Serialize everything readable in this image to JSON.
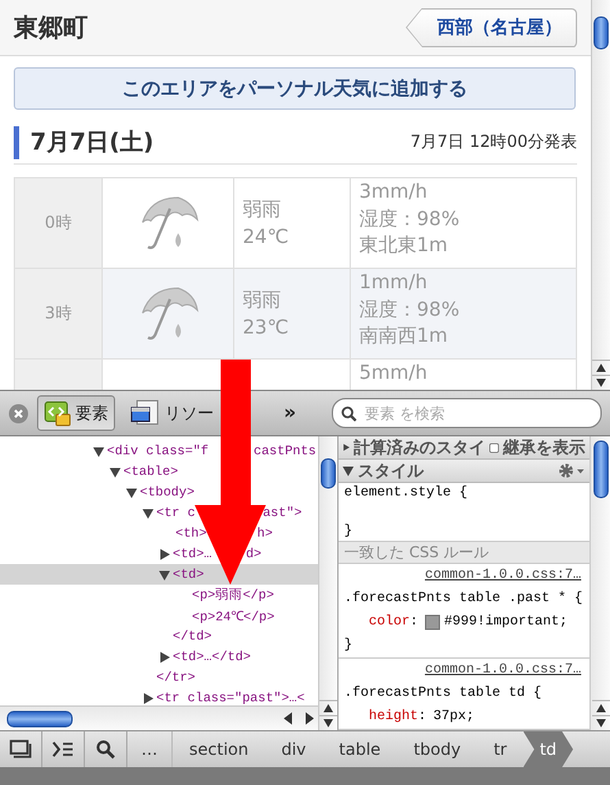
{
  "page": {
    "location": "東郷町",
    "region_button": "西部（名古屋）",
    "add_button": "このエリアをパーソナル天気に追加する",
    "date": "7月7日(土)",
    "published": "7月7日 12時00分発表",
    "forecast": [
      {
        "hour": "0時",
        "weather": "弱雨",
        "temp": "24℃",
        "precip": "3mm/h",
        "humidity": "湿度：98%",
        "wind": "東北東1m",
        "shaded": false
      },
      {
        "hour": "3時",
        "weather": "弱雨",
        "temp": "23℃",
        "precip": "1mm/h",
        "humidity": "湿度：98%",
        "wind": "南南西1m",
        "shaded": true
      },
      {
        "precip": "5mm/h",
        "shaded": false
      }
    ]
  },
  "inspector": {
    "tabs": [
      {
        "label": "要素",
        "selected": true
      },
      {
        "label": "リソー",
        "selected": false
      }
    ],
    "overflow": "»",
    "search": {
      "placeholder": "要素 を検索"
    },
    "dom_tree": [
      {
        "kind": "branch",
        "text": [
          "<div class=\"f",
          "castPnts"
        ],
        "expanded": true,
        "selected": false,
        "children": [
          {
            "kind": "branch",
            "text": [
              "<table>"
            ],
            "expanded": true,
            "selected": false,
            "children": [
              {
                "kind": "branch",
                "text": [
                  "<tbody>"
                ],
                "expanded": true,
                "selected": false,
                "children": [
                  {
                    "kind": "branch",
                    "text": [
                      "<tr c",
                      "ast\">"
                    ],
                    "expanded": true,
                    "selected": false,
                    "close": "</tr>",
                    "children": [
                      {
                        "kind": "leaf",
                        "text": [
                          "<th>",
                          "h>"
                        ],
                        "selected": false
                      },
                      {
                        "kind": "branch",
                        "text": [
                          "<td>…",
                          "d>"
                        ],
                        "expanded": false,
                        "selected": false
                      },
                      {
                        "kind": "branch",
                        "text": [
                          "<td>"
                        ],
                        "expanded": true,
                        "selected": true,
                        "close": "</td>",
                        "children": [
                          {
                            "kind": "leaf",
                            "text": [
                              "<p>弱雨</p>"
                            ],
                            "selected": false
                          },
                          {
                            "kind": "leaf",
                            "text": [
                              "<p>24℃</p>"
                            ],
                            "selected": false
                          }
                        ]
                      },
                      {
                        "kind": "branch",
                        "text": [
                          "<td>…</td>"
                        ],
                        "expanded": false,
                        "selected": false
                      }
                    ]
                  },
                  {
                    "kind": "branch",
                    "text": [
                      "<tr class=\"past\">…<"
                    ],
                    "expanded": false,
                    "selected": false
                  }
                ]
              }
            ]
          }
        ]
      }
    ],
    "computed_styles": {
      "label": "計算済みのスタイ",
      "expanded": false,
      "show_inherited": {
        "label": "継承を表示",
        "checked": false
      }
    },
    "styles": {
      "label": "スタイル",
      "expanded": true,
      "element_style": {
        "selector": "element.style {",
        "close": "}"
      }
    },
    "rules_header": "一致した CSS ルール",
    "rules": [
      {
        "source": "common-1.0.0.css:7…",
        "selector": ".forecastPnts table .past * {",
        "declarations": [
          {
            "property": "color",
            "separator": ":",
            "color": "#999999",
            "value": "#999!important;"
          }
        ],
        "close": "}"
      },
      {
        "source": "common-1.0.0.css:7…",
        "selector": ".forecastPnts table td {",
        "declarations": [
          {
            "property": "height",
            "separator": ":",
            "value": "37px;"
          }
        ]
      }
    ],
    "breadcrumbs": [
      {
        "label": "…",
        "selected": false
      },
      {
        "label": "section",
        "selected": false
      },
      {
        "label": "div",
        "selected": false
      },
      {
        "label": "table",
        "selected": false
      },
      {
        "label": "tbody",
        "selected": false
      },
      {
        "label": "tr",
        "selected": false
      },
      {
        "label": "td",
        "selected": true
      }
    ]
  }
}
